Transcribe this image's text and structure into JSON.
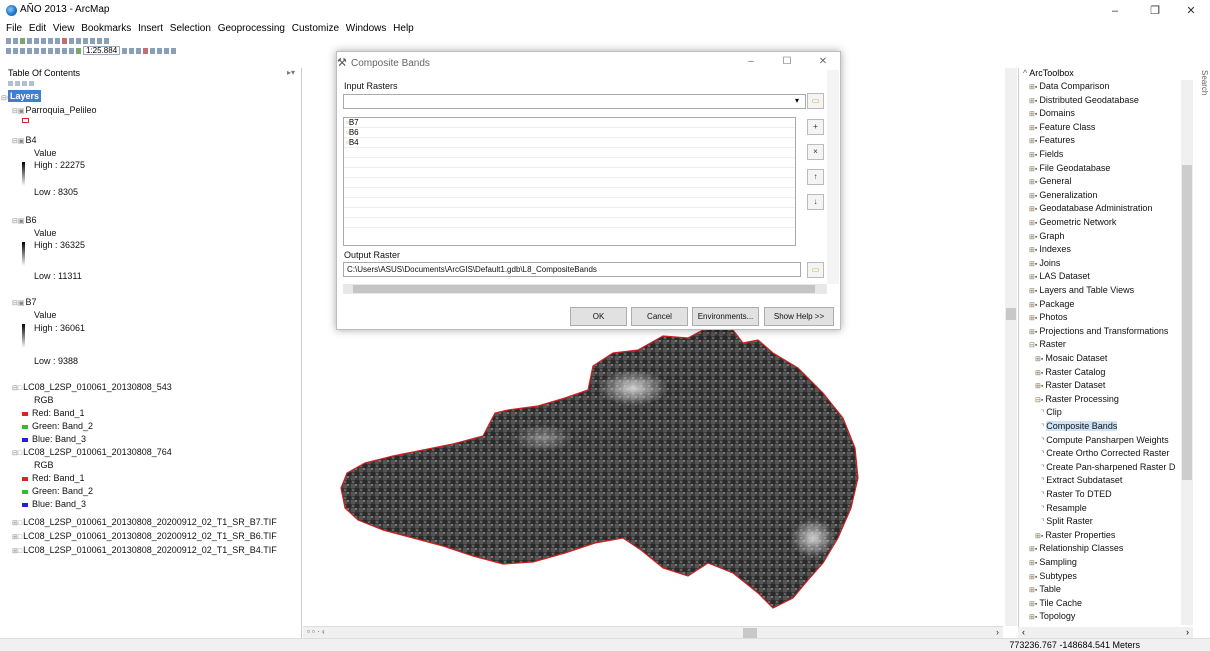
{
  "window": {
    "title": "AÑO 2013 - ArcMap",
    "controls": [
      "–",
      "❐",
      "✕"
    ]
  },
  "menu": [
    "File",
    "Edit",
    "View",
    "Bookmarks",
    "Insert",
    "Selection",
    "Geoprocessing",
    "Customize",
    "Windows",
    "Help"
  ],
  "toolbar": {
    "scale": "1:25.884"
  },
  "toc": {
    "title": "Table Of Contents",
    "root": "Layers",
    "items": {
      "parroquia": "Parroquia_Pelileo",
      "b4": {
        "name": "B4",
        "value": "Value",
        "high": "High : 22275",
        "low": "Low : 8305"
      },
      "b6": {
        "name": "B6",
        "value": "Value",
        "high": "High : 36325",
        "low": "Low : 11311"
      },
      "b7": {
        "name": "B7",
        "value": "Value",
        "high": "High : 36061",
        "low": "Low : 9388"
      },
      "c543": {
        "name": "LC08_L2SP_010061_20130808_543",
        "rgb": "RGB",
        "red": "Red:   Band_1",
        "green": "Green: Band_2",
        "blue": "Blue:  Band_3"
      },
      "c764": {
        "name": "LC08_L2SP_010061_20130808_764",
        "rgb": "RGB",
        "red": "Red:   Band_1",
        "green": "Green: Band_2",
        "blue": "Blue:  Band_3"
      },
      "tif_b7": "LC08_L2SP_010061_20130808_20200912_02_T1_SR_B7.TIF",
      "tif_b6": "LC08_L2SP_010061_20130808_20200912_02_T1_SR_B6.TIF",
      "tif_b4": "LC08_L2SP_010061_20130808_20200912_02_T1_SR_B4.TIF"
    }
  },
  "dialog": {
    "title": "Composite Bands",
    "input_label": "Input Rasters",
    "input_value": "",
    "rasters": [
      "B7",
      "B6",
      "B4"
    ],
    "output_label": "Output Raster",
    "output_value": "C:\\Users\\ASUS\\Documents\\ArcGIS\\Default1.gdb\\L8_CompositeBands",
    "buttons": {
      "ok": "OK",
      "cancel": "Cancel",
      "env": "Environments...",
      "help": "Show Help >>"
    }
  },
  "toolbox": {
    "title": "ArcToolbox",
    "search_tab": "Search",
    "items": [
      {
        "label": "Data Comparison",
        "level": 0
      },
      {
        "label": "Distributed Geodatabase",
        "level": 0
      },
      {
        "label": "Domains",
        "level": 0
      },
      {
        "label": "Feature Class",
        "level": 0
      },
      {
        "label": "Features",
        "level": 0
      },
      {
        "label": "Fields",
        "level": 0
      },
      {
        "label": "File Geodatabase",
        "level": 0
      },
      {
        "label": "General",
        "level": 0
      },
      {
        "label": "Generalization",
        "level": 0
      },
      {
        "label": "Geodatabase Administration",
        "level": 0
      },
      {
        "label": "Geometric Network",
        "level": 0
      },
      {
        "label": "Graph",
        "level": 0
      },
      {
        "label": "Indexes",
        "level": 0
      },
      {
        "label": "Joins",
        "level": 0
      },
      {
        "label": "LAS Dataset",
        "level": 0
      },
      {
        "label": "Layers and Table Views",
        "level": 0
      },
      {
        "label": "Package",
        "level": 0
      },
      {
        "label": "Photos",
        "level": 0
      },
      {
        "label": "Projections and Transformations",
        "level": 0
      },
      {
        "label": "Raster",
        "level": 0
      },
      {
        "label": "Mosaic Dataset",
        "level": 1
      },
      {
        "label": "Raster Catalog",
        "level": 1
      },
      {
        "label": "Raster Dataset",
        "level": 1
      },
      {
        "label": "Raster Processing",
        "level": 1
      },
      {
        "label": "Clip",
        "level": 2
      },
      {
        "label": "Composite Bands",
        "level": 2
      },
      {
        "label": "Compute Pansharpen Weights",
        "level": 2
      },
      {
        "label": "Create Ortho Corrected Raster",
        "level": 2
      },
      {
        "label": "Create Pan-sharpened Raster D",
        "level": 2
      },
      {
        "label": "Extract Subdataset",
        "level": 2
      },
      {
        "label": "Raster To DTED",
        "level": 2
      },
      {
        "label": "Resample",
        "level": 2
      },
      {
        "label": "Split Raster",
        "level": 2
      },
      {
        "label": "Raster Properties",
        "level": 1
      },
      {
        "label": "Relationship Classes",
        "level": 0
      },
      {
        "label": "Sampling",
        "level": 0
      },
      {
        "label": "Subtypes",
        "level": 0
      },
      {
        "label": "Table",
        "level": 0
      },
      {
        "label": "Tile Cache",
        "level": 0
      },
      {
        "label": "Topology",
        "level": 0
      }
    ]
  },
  "status": {
    "coords": "773236.767  -148684.541 Meters"
  }
}
